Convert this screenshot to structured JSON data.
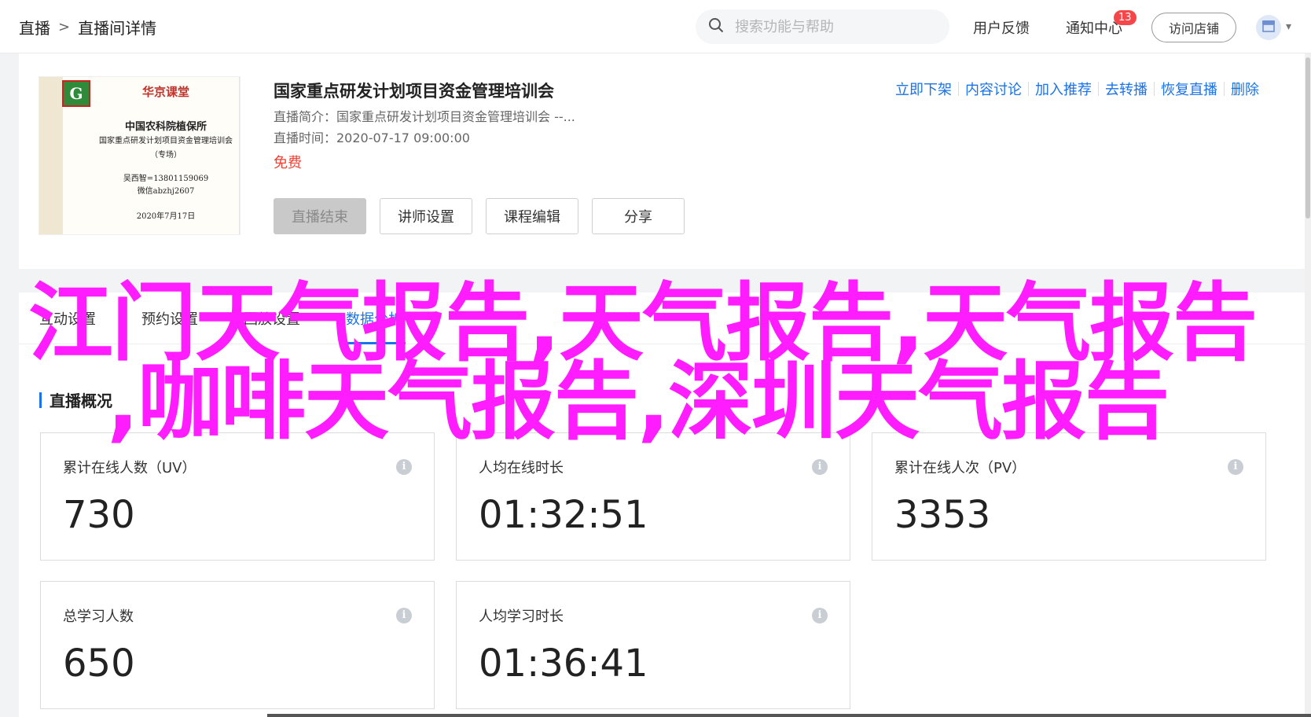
{
  "breadcrumb": {
    "root": "直播",
    "separator": ">",
    "current": "直播间详情"
  },
  "search": {
    "placeholder": "搜索功能与帮助"
  },
  "top_nav": {
    "feedback": "用户反馈",
    "notifications": "通知中心",
    "notification_count": "13",
    "visit_store": "访问店铺"
  },
  "course": {
    "poster": {
      "brand": "华京课堂",
      "org": "中国农科院植保所",
      "subtitle": "国家重点研发计划项目资金管理培训会",
      "note": "（专场）",
      "contact1": "吴西智=13801159069",
      "contact2": "微信abzhj2607",
      "date": "2020年7月17日"
    },
    "title": "国家重点研发计划项目资金管理培训会",
    "intro": "直播简介：国家重点研发计划项目资金管理培训会 --...",
    "time": "直播时间：2020-07-17 09:00:00",
    "price": "免费",
    "buttons": [
      "直播结束",
      "讲师设置",
      "课程编辑",
      "分享"
    ],
    "actions": [
      "立即下架",
      "内容讨论",
      "加入推荐",
      "去转播",
      "恢复直播",
      "删除"
    ]
  },
  "tabs": [
    "互动设置",
    "预约设置",
    "回放设置",
    "数据分析"
  ],
  "overview": {
    "title": "直播概况",
    "stats": [
      {
        "label": "累计在线人数（UV）",
        "value": "730"
      },
      {
        "label": "人均在线时长",
        "value": "01:32:51"
      },
      {
        "label": "累计在线人次（PV）",
        "value": "3353"
      },
      {
        "label": "总学习人数",
        "value": "650"
      },
      {
        "label": "人均学习时长",
        "value": "01:36:41"
      }
    ]
  },
  "overlay": {
    "line1": "江门天气报告,天气报告,天气报告",
    "line2": ",咖啡天气报告,深圳天气报告"
  },
  "colors": {
    "accent": "#1a73e8",
    "price": "#f04134",
    "overlay": "#ff1dff",
    "badge": "#f5474a"
  }
}
